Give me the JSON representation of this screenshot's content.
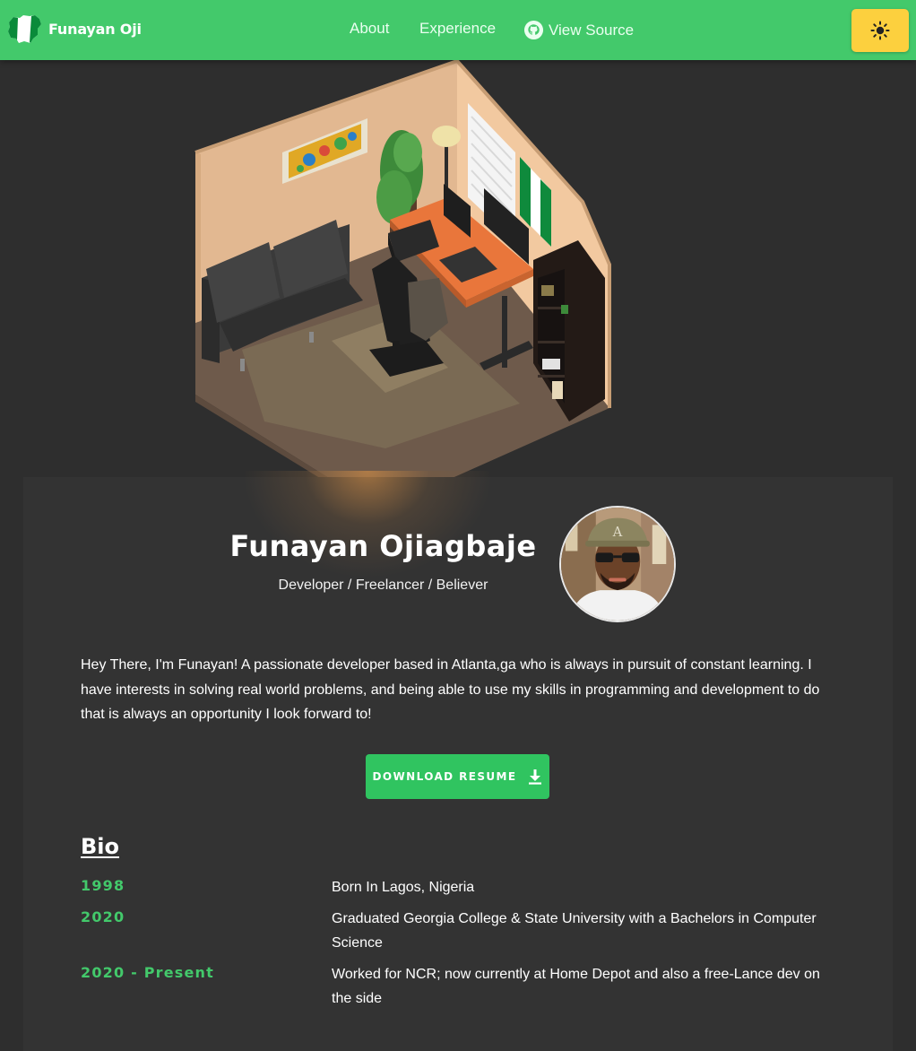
{
  "nav": {
    "brand_name": "Funayan Oji",
    "links": [
      {
        "label": "About"
      },
      {
        "label": "Experience"
      },
      {
        "label": "View Source"
      }
    ]
  },
  "hero": {
    "name": "Funayan Ojiagbaje",
    "subtitle": "Developer / Freelancer / Believer"
  },
  "intro": "Hey There, I'm Funayan! A passionate developer based in Atlanta,ga who is always in pursuit of constant learning. I have interests in solving real world problems, and being able to use my skills in programming and development to do that is always an opportunity I look forward to!",
  "resume_button": "Download Resume",
  "bio": {
    "heading": "Bio",
    "entries": [
      {
        "year": "1998",
        "text": "Born In Lagos, Nigeria"
      },
      {
        "year": "2020",
        "text": "Graduated Georgia College & State University with a Bachelors in Computer Science"
      },
      {
        "year": "2020 - Present",
        "text": "Worked for NCR; now currently at Home Depot and also a free-Lance dev on the side"
      }
    ]
  },
  "colors": {
    "accent_green": "#43c96b",
    "button_green": "#30c460",
    "theme_button_yellow": "#fcd03e",
    "background": "#2e2e2e",
    "card_background": "#333333"
  },
  "icons": [
    "nigeria-map-logo-icon",
    "github-icon",
    "sun-icon",
    "download-icon"
  ]
}
